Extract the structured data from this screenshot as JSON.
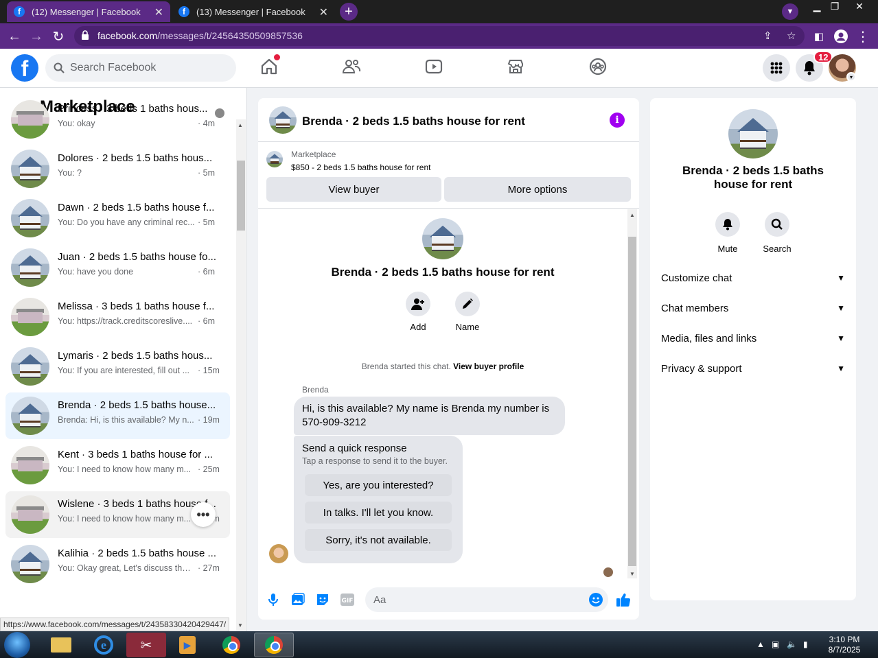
{
  "browser": {
    "tabs": [
      {
        "title": "(12) Messenger | Facebook",
        "active": true
      },
      {
        "title": "(13) Messenger | Facebook",
        "active": false
      }
    ],
    "url_host": "facebook.com",
    "url_path": "/messages/t/24564350509857536",
    "status_url": "https://www.facebook.com/messages/t/24358330420429447/"
  },
  "fb": {
    "logo": "f",
    "search_placeholder": "Search Facebook",
    "notification_count": "12",
    "nav_icons": [
      "home-icon",
      "friends-icon",
      "watch-icon",
      "marketplace-icon",
      "groups-icon"
    ]
  },
  "left": {
    "title": "Marketplace",
    "conversations": [
      {
        "title": "Princess · 3 beds 1 baths hous...",
        "preview": "You: okay",
        "time": "· 4m",
        "thumb": "house2"
      },
      {
        "title": "Dolores · 2 beds 1.5 baths hous...",
        "preview": "You: ?",
        "time": "· 5m",
        "thumb": "house"
      },
      {
        "title": "Dawn · 2 beds 1.5 baths house f...",
        "preview": "You: Do you have any criminal rec...",
        "time": "· 5m",
        "thumb": "house"
      },
      {
        "title": "Juan · 2 beds 1.5 baths house fo...",
        "preview": "You: have you done",
        "time": "· 6m",
        "thumb": "house"
      },
      {
        "title": "Melissa · 3 beds 1 baths house f...",
        "preview": "You: https://track.creditscoreslive....",
        "time": "· 6m",
        "thumb": "house2"
      },
      {
        "title": "Lymaris · 2 beds 1.5 baths hous...",
        "preview": "You: If you are interested, fill out ...",
        "time": "· 15m",
        "thumb": "house"
      },
      {
        "title": "Brenda · 2 beds 1.5 baths house...",
        "preview": "Brenda: Hi, is this available? My n...",
        "time": "· 19m",
        "thumb": "house"
      },
      {
        "title": "Kent · 3 beds 1 baths house for ...",
        "preview": "You: I need to know how many m...",
        "time": "· 25m",
        "thumb": "house2"
      },
      {
        "title": "Wislene · 3 beds 1 baths house f...",
        "preview": "You: I need to know how many m...",
        "time": "· 27m",
        "thumb": "house2"
      },
      {
        "title": "Kalihia · 2 beds 1.5 baths house ...",
        "preview": "You: Okay great, Let's discuss the ...",
        "time": "· 27m",
        "thumb": "house"
      }
    ]
  },
  "chat": {
    "title": "Brenda · 2 beds 1.5 baths house for rent",
    "marketplace_label": "Marketplace",
    "listing": "$850 - 2 beds 1.5 baths house for rent",
    "view_buyer": "View buyer",
    "more_options": "More options",
    "add_label": "Add",
    "name_label": "Name",
    "started_text": "Brenda started this chat.",
    "view_buyer_profile": "View buyer profile",
    "sender": "Brenda",
    "message": "Hi, is this available? My name is Brenda my number is 570-909-3212",
    "quick_title": "Send a quick response",
    "quick_subtitle": "Tap a response to send it to the buyer.",
    "quick_responses": [
      "Yes, are you interested?",
      "In talks. I'll let you know.",
      "Sorry, it's not available."
    ],
    "input_placeholder": "Aa"
  },
  "info": {
    "title": "Brenda · 2 beds 1.5 baths house for rent",
    "mute": "Mute",
    "search": "Search",
    "sections": [
      "Customize chat",
      "Chat members",
      "Media, files and links",
      "Privacy & support"
    ]
  },
  "taskbar": {
    "time": "3:10 PM",
    "date": "8/7/2025"
  },
  "colors": {
    "chrome_purple": "#5b2a86",
    "fb_blue": "#1877f2",
    "info_purple": "#a000f0",
    "selected_bg": "#ebf5ff"
  }
}
